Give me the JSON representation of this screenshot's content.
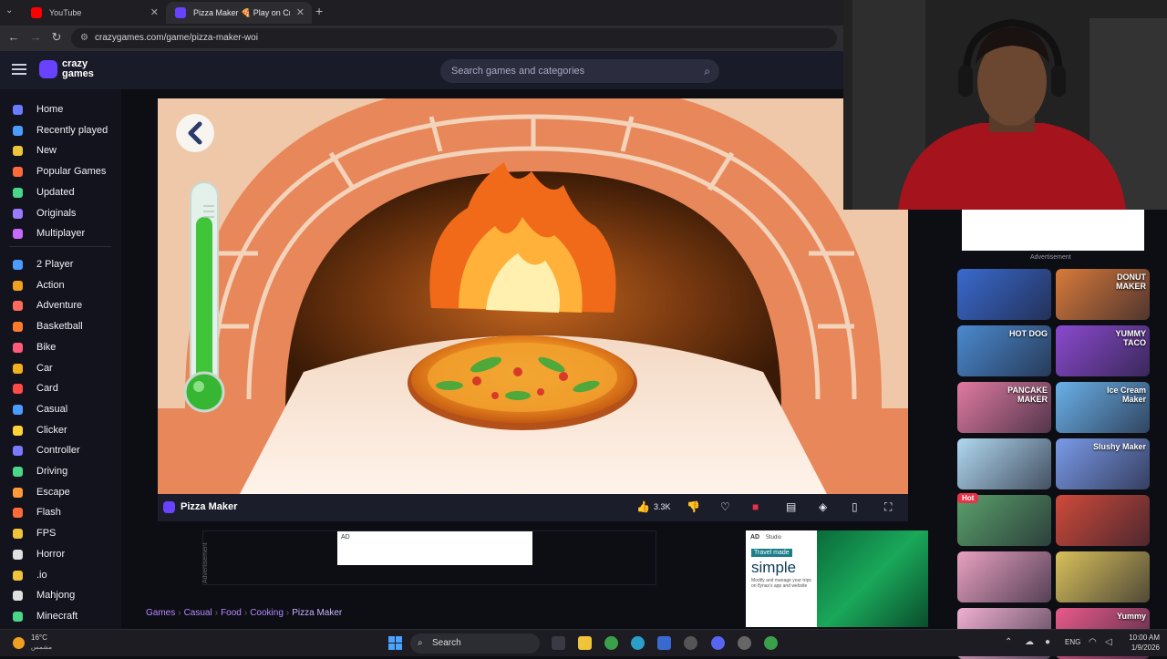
{
  "browser": {
    "tabs": [
      {
        "title": "YouTube",
        "active": false
      },
      {
        "title": "Pizza Maker 🍕 Play on Cra",
        "active": true
      }
    ],
    "url": "crazygames.com/game/pizza-maker-woi"
  },
  "header": {
    "logo_text_line1": "crazy",
    "logo_text_line2": "games",
    "search_placeholder": "Search games and categories"
  },
  "sidebar": {
    "main_items": [
      {
        "label": "Home",
        "icon": "home-icon",
        "color": "#6a7bff"
      },
      {
        "label": "Recently played",
        "icon": "clock-icon",
        "color": "#4a9cff"
      },
      {
        "label": "New",
        "icon": "sparkle-icon",
        "color": "#f0c43a"
      },
      {
        "label": "Popular Games",
        "icon": "fire-icon",
        "color": "#ff6a3a"
      },
      {
        "label": "Updated",
        "icon": "refresh-icon",
        "color": "#4ad68a"
      },
      {
        "label": "Originals",
        "icon": "originals-icon",
        "color": "#9a7bff"
      },
      {
        "label": "Multiplayer",
        "icon": "multiplayer-icon",
        "color": "#c86aff"
      }
    ],
    "categories": [
      {
        "label": "2 Player",
        "icon": "two-player-icon",
        "color": "#4a9cff"
      },
      {
        "label": "Action",
        "icon": "sword-icon",
        "color": "#f0a020"
      },
      {
        "label": "Adventure",
        "icon": "compass-icon",
        "color": "#ff6a5a"
      },
      {
        "label": "Basketball",
        "icon": "basketball-icon",
        "color": "#ff7a2a"
      },
      {
        "label": "Bike",
        "icon": "bike-icon",
        "color": "#ff5a7a"
      },
      {
        "label": "Car",
        "icon": "car-icon",
        "color": "#f0b020"
      },
      {
        "label": "Card",
        "icon": "card-icon",
        "color": "#ff4a4a"
      },
      {
        "label": "Casual",
        "icon": "casual-icon",
        "color": "#4a9cff"
      },
      {
        "label": "Clicker",
        "icon": "cursor-icon",
        "color": "#ffd23a"
      },
      {
        "label": "Controller",
        "icon": "controller-icon",
        "color": "#7a7aff"
      },
      {
        "label": "Driving",
        "icon": "steering-icon",
        "color": "#4ad68a"
      },
      {
        "label": "Escape",
        "icon": "door-icon",
        "color": "#ff9a3a"
      },
      {
        "label": "Flash",
        "icon": "flash-icon",
        "color": "#ff6a3a"
      },
      {
        "label": "FPS",
        "icon": "gun-icon",
        "color": "#f0c43a"
      },
      {
        "label": "Horror",
        "icon": "ghost-icon",
        "color": "#e0e0e0"
      },
      {
        "label": ".io",
        "icon": "io-icon",
        "color": "#f0c43a"
      },
      {
        "label": "Mahjong",
        "icon": "mahjong-icon",
        "color": "#e0e0e0"
      },
      {
        "label": "Minecraft",
        "icon": "block-icon",
        "color": "#4ad68a"
      }
    ]
  },
  "game_bar": {
    "title": "Pizza Maker",
    "likes": "3.3K"
  },
  "ads": {
    "banner_label": "AD",
    "vertical_label": "Advertisement",
    "right_ad_label": "AD",
    "right_ad_brand": "Studio",
    "right_ad_tag": "Travel made",
    "right_ad_headline": "simple",
    "right_ad_body": "Modify and manage your trips on flynas's app and website",
    "side_label": "Advertisement"
  },
  "breadcrumb": [
    "Games",
    "Casual",
    "Food",
    "Cooking",
    "Pizza Maker"
  ],
  "recommended": [
    {
      "title": "",
      "color": "#3a6acf"
    },
    {
      "title": "DONUT MAKER",
      "color": "#d87a3a"
    },
    {
      "title": "HOT DOG",
      "color": "#4a8acf"
    },
    {
      "title": "YUMMY TACO",
      "color": "#8a4acf"
    },
    {
      "title": "PANCAKE MAKER",
      "color": "#e07aa0"
    },
    {
      "title": "Ice Cream Maker",
      "color": "#6ab0e8"
    },
    {
      "title": "",
      "color": "#b0d8f0"
    },
    {
      "title": "Slushy Maker",
      "color": "#7a9ae8"
    },
    {
      "title": "",
      "color": "#5aa06a"
    },
    {
      "title": "",
      "color": "#cf4a3a"
    },
    {
      "title": "",
      "color": "#e8a0c0"
    },
    {
      "title": "",
      "color": "#d8c05a"
    },
    {
      "title": "",
      "color": "#f0b0d0"
    },
    {
      "title": "Yummy",
      "color": "#e85a8a"
    }
  ],
  "hot_badge": "Hot",
  "taskbar": {
    "temp": "16°C",
    "condition": "مشمس",
    "search": "Search",
    "lang": "ENG",
    "time": "10:00 AM",
    "date": "1/9/2026"
  }
}
